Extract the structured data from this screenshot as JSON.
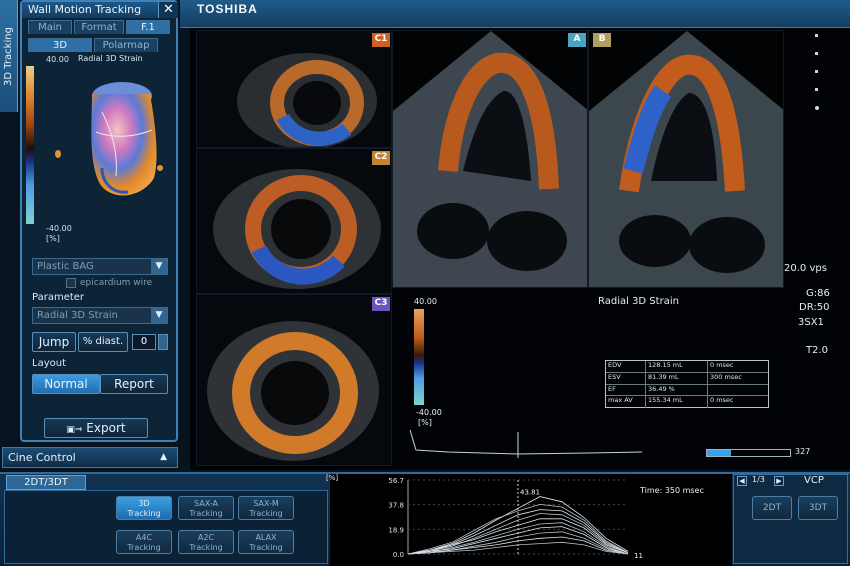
{
  "sidebar_tab": {
    "label": "3D Tracking"
  },
  "tracking_panel": {
    "title": "Wall Motion Tracking",
    "tabs_row1": [
      "Main",
      "Format",
      "F.1"
    ],
    "tabs_row2": [
      "3D",
      "Polarmap"
    ],
    "polarmap_title": "Radial 3D Strain",
    "scale_max": "40.00",
    "scale_min": "-40.00",
    "scale_unit": "[%]",
    "surface_dropdown": "Plastic BAG",
    "epicardium_label": "epicardium wire",
    "parameter_label": "Parameter",
    "parameter_dropdown": "Radial 3D Strain",
    "jump_label": "Jump",
    "diast_label": "% diast.",
    "diast_value": "0",
    "layout_label": "Layout",
    "normal_label": "Normal",
    "report_label": "Report",
    "export_label": "Export"
  },
  "cine": {
    "label": "Cine Control"
  },
  "header": {
    "brand": "TOSHIBA"
  },
  "views": {
    "c1": "C1",
    "c2": "C2",
    "c3": "C3",
    "a": "A",
    "b": "B"
  },
  "info": {
    "vps": "20.0 vps",
    "g": "G:86",
    "dr": "DR:50",
    "probe": "3SX1",
    "t": "T2.0",
    "strain_title": "Radial 3D Strain",
    "color_max": "40.00",
    "color_min": "-40.00",
    "color_unit": "[%]",
    "frame_count": "327"
  },
  "volume_table": [
    [
      "EDV",
      "128.15 mL",
      "0 msec"
    ],
    [
      "ESV",
      "81.39 mL",
      "300 msec"
    ],
    [
      "EF",
      "36.49 %",
      ""
    ],
    [
      "max AV",
      "155.34 mL",
      "0 msec"
    ]
  ],
  "bottom": {
    "mode_tab": "2DT/3DT",
    "tracking_buttons": [
      [
        "3D",
        "Tracking"
      ],
      [
        "SAX-A",
        "Tracking"
      ],
      [
        "SAX-M",
        "Tracking"
      ],
      [
        "A4C",
        "Tracking"
      ],
      [
        "A2C",
        "Tracking"
      ],
      [
        "ALAX",
        "Tracking"
      ]
    ],
    "graph_unit": "[%]",
    "graph_time": "Time: 350 msec",
    "graph_peak": "43.81",
    "graph_end": "11",
    "vcp_label": "VCP",
    "vcp_page": "1/3",
    "vcp_buttons": [
      "2DT",
      "3DT"
    ]
  },
  "chart_data": {
    "type": "line",
    "title": "",
    "xlabel": "",
    "ylabel": "[%]",
    "yticks": [
      0.0,
      18.9,
      37.8,
      56.7
    ],
    "ylim": [
      0,
      56.7
    ],
    "x": [
      0,
      1,
      2,
      3,
      4,
      5,
      6,
      7,
      8,
      9,
      10
    ],
    "series": [
      {
        "values": [
          0,
          3,
          8,
          16,
          26,
          35,
          44,
          40,
          28,
          12,
          2
        ]
      },
      {
        "values": [
          0,
          4,
          9,
          18,
          27,
          33,
          38,
          36,
          26,
          10,
          1
        ]
      },
      {
        "values": [
          0,
          2,
          7,
          14,
          22,
          30,
          34,
          33,
          24,
          9,
          1
        ]
      },
      {
        "values": [
          0,
          2,
          6,
          12,
          19,
          26,
          31,
          30,
          22,
          8,
          1
        ]
      },
      {
        "values": [
          0,
          3,
          7,
          11,
          17,
          22,
          27,
          27,
          20,
          7,
          1
        ]
      },
      {
        "values": [
          0,
          1,
          5,
          9,
          14,
          19,
          23,
          24,
          17,
          6,
          0
        ]
      },
      {
        "values": [
          0,
          2,
          4,
          8,
          12,
          16,
          20,
          21,
          15,
          5,
          0
        ]
      },
      {
        "values": [
          0,
          1,
          3,
          6,
          9,
          13,
          16,
          17,
          12,
          4,
          0
        ]
      },
      {
        "values": [
          0,
          1,
          3,
          5,
          7,
          10,
          12,
          13,
          10,
          3,
          0
        ]
      },
      {
        "values": [
          0,
          1,
          2,
          3,
          5,
          7,
          8,
          9,
          7,
          2,
          0
        ]
      }
    ],
    "cursor_x": 5,
    "peak_label": "43.81"
  }
}
